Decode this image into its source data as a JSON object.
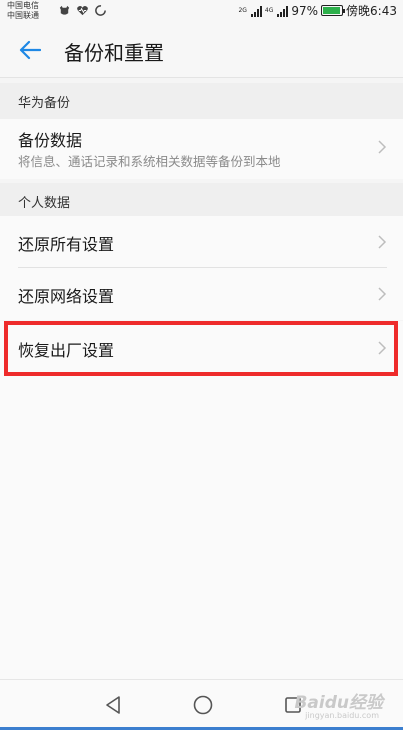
{
  "status_bar": {
    "carrier_1": "中国电信",
    "carrier_2": "中国联通",
    "net_1": "2G",
    "net_2": "4G",
    "battery_percent_label": "97%",
    "battery_level": 0.97,
    "time": "傍晚6:43"
  },
  "header": {
    "title": "备份和重置",
    "back_icon": "back-arrow-icon"
  },
  "sections": {
    "huawei_backup": {
      "header": "华为备份",
      "item_title": "备份数据",
      "item_subtitle": "将信息、通话记录和系统相关数据等备份到本地"
    },
    "personal_data": {
      "header": "个人数据",
      "items": [
        {
          "label": "还原所有设置"
        },
        {
          "label": "还原网络设置"
        },
        {
          "label": "恢复出厂设置"
        }
      ]
    }
  },
  "nav_bar": {
    "back_icon": "triangle-back-icon",
    "home_icon": "circle-home-icon",
    "recents_icon": "square-recents-icon"
  },
  "watermark": {
    "text": "Baidu经验",
    "sub": "jingyan.baidu.com"
  },
  "colors": {
    "accent": "#1e88e5",
    "highlight": "#ee2b2b",
    "battery": "#2db04b"
  }
}
